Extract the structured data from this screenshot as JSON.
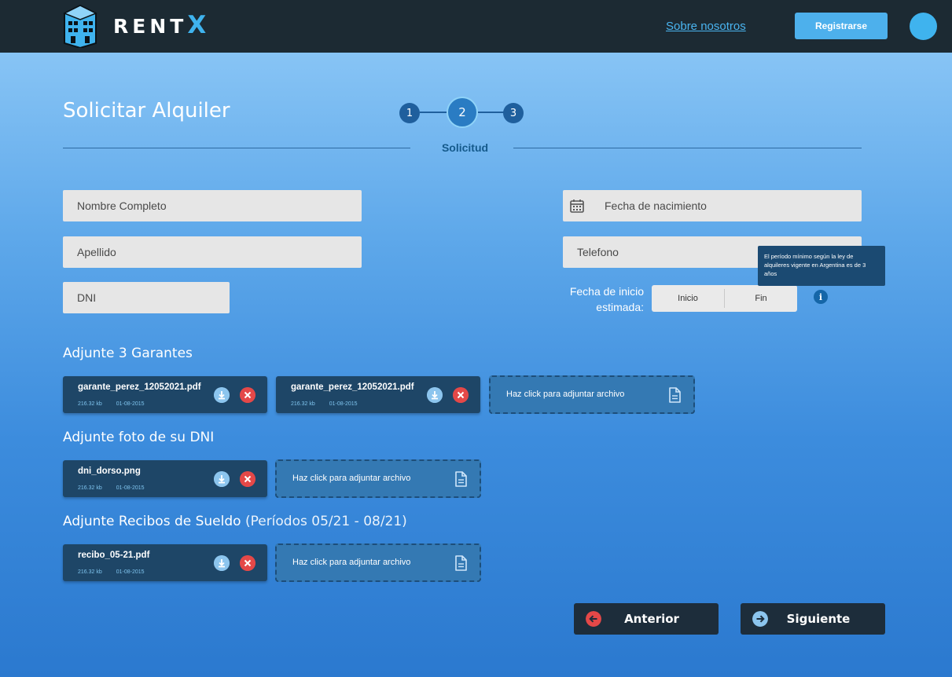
{
  "header": {
    "brand_prefix": "RENT",
    "brand_suffix": "X",
    "about_link": "Sobre nosotros",
    "register_button": "Registrarse"
  },
  "page": {
    "title": "Solicitar Alquiler",
    "steps": [
      "1",
      "2",
      "3"
    ],
    "active_step": 2,
    "section_label": "Solicitud"
  },
  "form": {
    "nombre_placeholder": "Nombre Completo",
    "apellido_placeholder": "Apellido",
    "dni_placeholder": "DNI",
    "nacimiento_placeholder": "Fecha de nacimiento",
    "telefono_placeholder": "Telefono",
    "fecha_inicio_label_1": "Fecha de inicio",
    "fecha_inicio_label_2": "estimada:",
    "range_start": "Inicio",
    "range_end": "Fin",
    "tooltip": "El período mínimo según la ley de alquileres vigente en Argentina es de 3 años",
    "info_glyph": "i"
  },
  "attachments": {
    "upload_prompt": "Haz click para adjuntar archivo",
    "garantes": {
      "title": "Adjunte 3 Garantes",
      "files": [
        {
          "name": "garante_perez_12052021.pdf",
          "size": "216.32 kb",
          "date": "01-08-2015"
        },
        {
          "name": "garante_perez_12052021.pdf",
          "size": "216.32 kb",
          "date": "01-08-2015"
        }
      ]
    },
    "dni": {
      "title": "Adjunte foto de su DNI",
      "files": [
        {
          "name": "dni_dorso.png",
          "size": "216.32 kb",
          "date": "01-08-2015"
        }
      ]
    },
    "recibos": {
      "title": "Adjunte Recibos de Sueldo",
      "title_extra": "(Períodos 05/21 - 08/21)",
      "files": [
        {
          "name": "recibo_05-21.pdf",
          "size": "216.32 kb",
          "date": "01-08-2015"
        }
      ]
    }
  },
  "footer": {
    "prev_button": "Anterior",
    "next_button": "Siguiente"
  },
  "colors": {
    "topbar": "#1c2a33",
    "accent": "#3fb3ee",
    "step": "#1f5f9d",
    "card": "#1e4667",
    "danger": "#e44848"
  },
  "icons": [
    "building-logo-icon",
    "calendar-icon",
    "info-icon",
    "download-icon",
    "remove-icon",
    "document-icon",
    "arrow-left-icon",
    "arrow-right-icon"
  ]
}
